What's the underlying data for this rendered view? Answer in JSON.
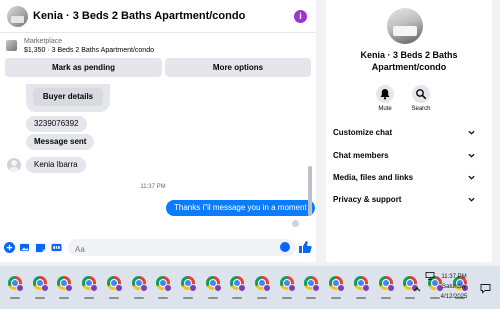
{
  "chat": {
    "title": "Kenia · 3 Beds 2 Baths Apartment/condo",
    "listing_label": "Marketplace",
    "listing_info": "$1,350 · 3 Beds 2 Baths Apartment/condo",
    "mark_pending_label": "Mark as pending",
    "more_options_label": "More options",
    "buyer_details_label": "Buyer details",
    "phone_message": "3239076392",
    "message_sent_label": "Message sent",
    "sender_name": "Kenia Ibarra",
    "timestamp": "11:37 PM",
    "outgoing_message": "Thanks i\"il message you in a moment",
    "composer_placeholder": "Aa"
  },
  "info_panel": {
    "title": "Kenia · 3 Beds 2 Baths Apartment/condo",
    "actions": [
      {
        "label": "Mute",
        "icon": "bell-icon"
      },
      {
        "label": "Search",
        "icon": "search-icon"
      }
    ],
    "sections": [
      {
        "label": "Customize chat"
      },
      {
        "label": "Chat members"
      },
      {
        "label": "Media, files and links"
      },
      {
        "label": "Privacy & support"
      }
    ]
  },
  "taskbar": {
    "app_count": 19,
    "app_icon": "chrome-icon",
    "time": "11:37 PM",
    "day": "Saturday",
    "date": "4/12/2025"
  },
  "colors": {
    "accent_blue": "#0866ff",
    "outgoing_bubble": "#0a7cff",
    "incoming_bubble": "#e4e6eb",
    "info_purple": "#9b34d1",
    "taskbar_bg": "#dde3ed"
  }
}
